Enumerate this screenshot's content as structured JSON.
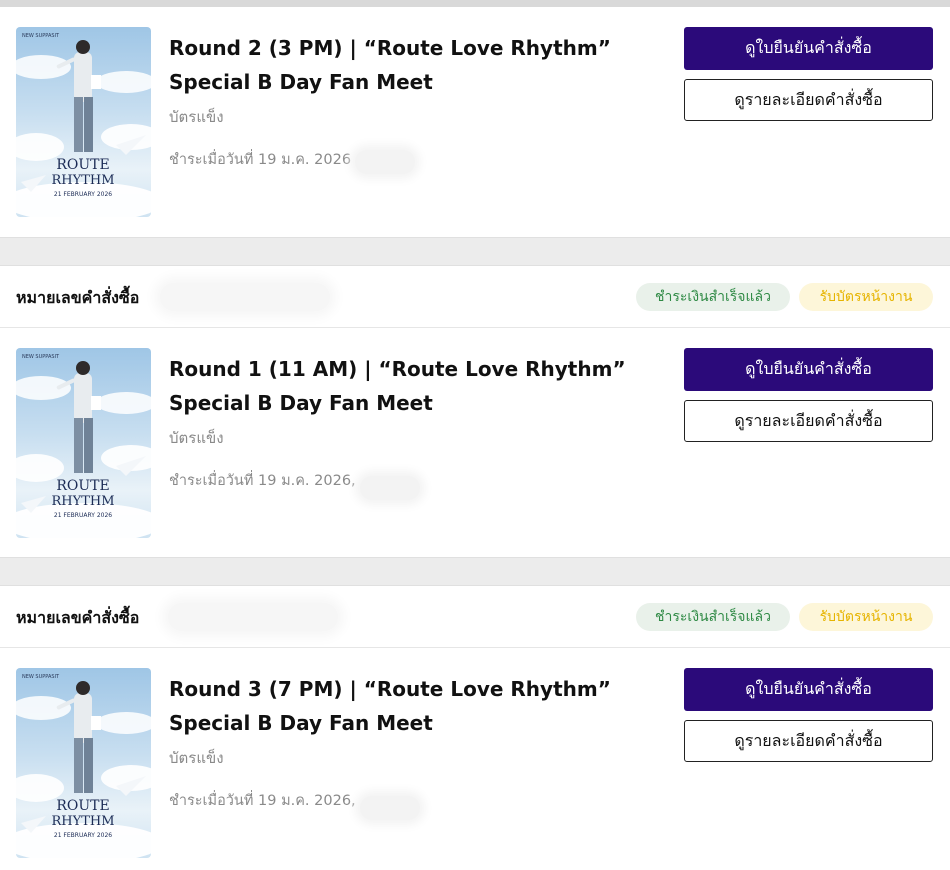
{
  "labels": {
    "order_number": "หมายเลขคำสั่งซื้อ",
    "badge_paid": "ชำระเงินสำเร็จแล้ว",
    "badge_pickup": "รับบัตรหน้างาน",
    "btn_confirmation": "ดูใบยืนยันคำสั่งซื้อ",
    "btn_details": "ดูรายละเอียดคำสั่งซื้อ"
  },
  "poster": {
    "brand_tag": "NEW SUPPASIT",
    "title_line1": "ROUTE",
    "title_line2": "RHYTHM",
    "date": "21 FEBRUARY 2026"
  },
  "orders": [
    {
      "title_line1": "Round 2 (3 PM) | “Route Love Rhythm”",
      "title_line2": "Special B Day Fan Meet",
      "ticket_type": "บัตรแข็ง",
      "paid_on": "ชำระเมื่อวันที่ 19 ม.ค. 2026"
    },
    {
      "title_line1": "Round 1 (11 AM) | “Route Love Rhythm”",
      "title_line2": "Special B Day Fan Meet",
      "ticket_type": "บัตรแข็ง",
      "paid_on": "ชำระเมื่อวันที่ 19 ม.ค. 2026,"
    },
    {
      "title_line1": "Round 3 (7 PM) | “Route Love Rhythm”",
      "title_line2": "Special B Day Fan Meet",
      "ticket_type": "บัตรแข็ง",
      "paid_on": "ชำระเมื่อวันที่ 19 ม.ค. 2026,"
    }
  ]
}
